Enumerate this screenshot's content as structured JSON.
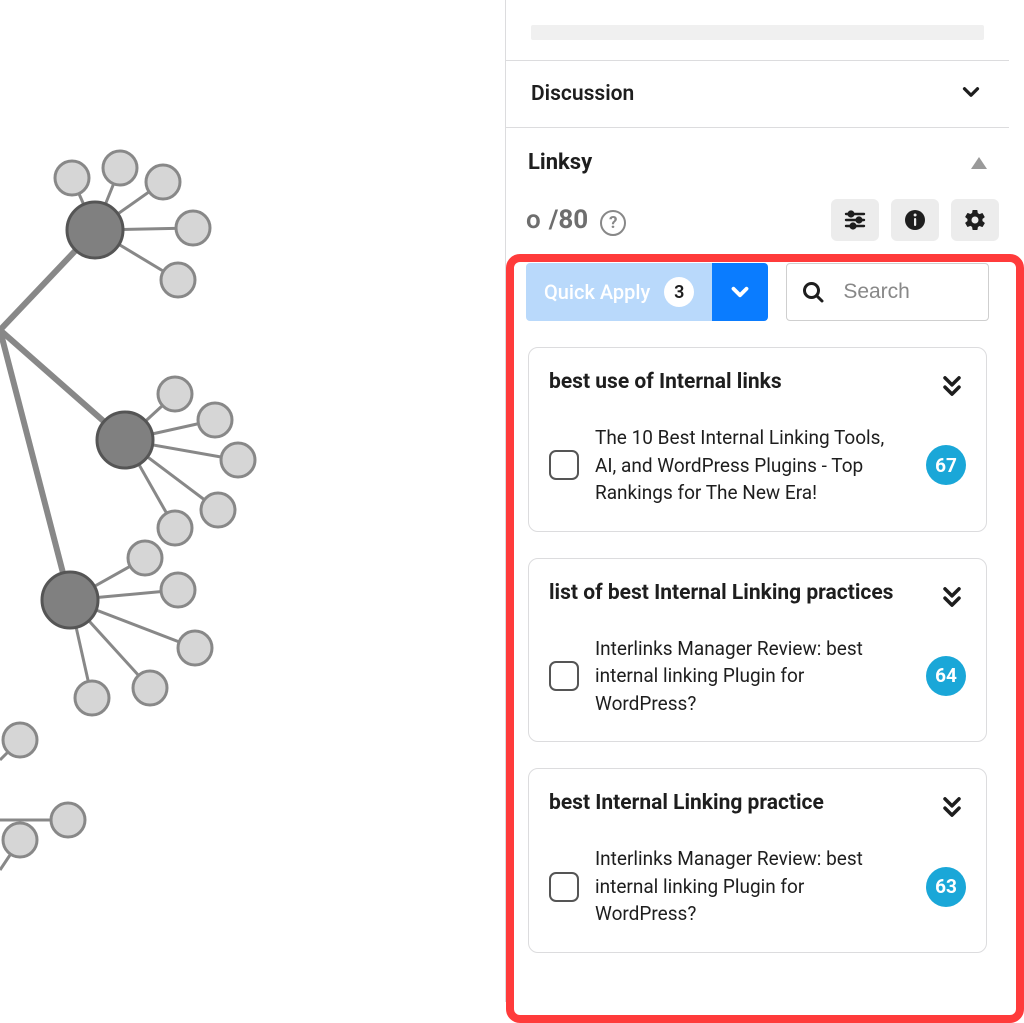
{
  "discussion": {
    "title": "Discussion"
  },
  "linksy": {
    "title": "Linksy",
    "count_current": "o",
    "count_max": "/80",
    "quick_apply_label": "Quick Apply",
    "quick_apply_count": "3",
    "search_placeholder": "Search",
    "suggestions": [
      {
        "keyword": "best use of Internal links",
        "snippet": "The 10 Best Internal Linking Tools, AI, and WordPress Plugins - Top Rankings for The New Era!",
        "score": "67"
      },
      {
        "keyword": "list of best Internal Linking practices",
        "snippet": "Interlinks Manager Review: best internal linking Plugin for WordPress?",
        "score": "64"
      },
      {
        "keyword": "best Internal Linking practice",
        "snippet": "Interlinks Manager Review: best internal linking Plugin for WordPress?",
        "score": "63"
      }
    ]
  }
}
